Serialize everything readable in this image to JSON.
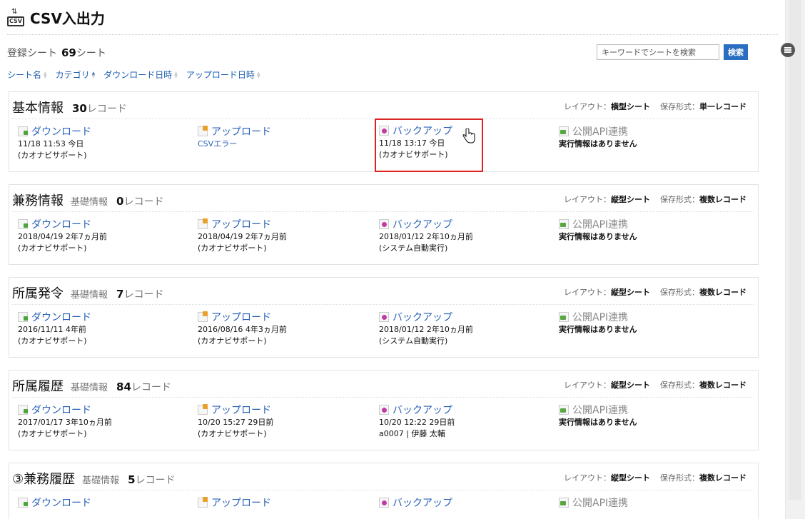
{
  "header": {
    "title": "CSV入出力",
    "icon_text": "CSV"
  },
  "summary": {
    "label": "登録シート",
    "count": "69",
    "unit": "シート"
  },
  "search": {
    "placeholder": "キーワードでシートを検索",
    "button": "検索"
  },
  "sort": [
    {
      "label": "シート名",
      "state": "none"
    },
    {
      "label": "カテゴリ",
      "state": "asc"
    },
    {
      "label": "ダウンロード日時",
      "state": "none"
    },
    {
      "label": "アップロード日時",
      "state": "none"
    }
  ],
  "meta_labels": {
    "layout": "レイアウト：",
    "format": "保存形式："
  },
  "action_labels": {
    "download": "ダウンロード",
    "upload": "アップロード",
    "backup": "バックアップ",
    "api": "公開API連携"
  },
  "cards": [
    {
      "name": "基本情報",
      "category": "",
      "count": "30",
      "unit": "レコード",
      "layout": "横型シート",
      "format": "単一レコード",
      "download": {
        "l1": "11/18 11:53 今日",
        "l2": "(カオナビサポート)"
      },
      "upload": {
        "l1": "CSVエラー",
        "l2": ""
      },
      "backup": {
        "l1": "11/18 13:17 今日",
        "l2": "(カオナビサポート)"
      },
      "api": {
        "l1": "実行情報はありません"
      }
    },
    {
      "name": "兼務情報",
      "category": "基礎情報",
      "count": "0",
      "unit": "レコード",
      "layout": "縦型シート",
      "format": "複数レコード",
      "download": {
        "l1": "2018/04/19 2年7ヵ月前",
        "l2": "(カオナビサポート)"
      },
      "upload": {
        "l1": "2018/04/19 2年7ヵ月前",
        "l2": "(カオナビサポート)"
      },
      "backup": {
        "l1": "2018/01/12 2年10ヵ月前",
        "l2": "(システム自動実行)"
      },
      "api": {
        "l1": "実行情報はありません"
      }
    },
    {
      "name": "所属発令",
      "category": "基礎情報",
      "count": "7",
      "unit": "レコード",
      "layout": "縦型シート",
      "format": "複数レコード",
      "download": {
        "l1": "2016/11/11 4年前",
        "l2": "(カオナビサポート)"
      },
      "upload": {
        "l1": "2016/08/16 4年3ヵ月前",
        "l2": "(カオナビサポート)"
      },
      "backup": {
        "l1": "2018/01/12 2年10ヵ月前",
        "l2": "(システム自動実行)"
      },
      "api": {
        "l1": "実行情報はありません"
      }
    },
    {
      "name": "所属履歴",
      "category": "基礎情報",
      "count": "84",
      "unit": "レコード",
      "layout": "縦型シート",
      "format": "複数レコード",
      "download": {
        "l1": "2017/01/17 3年10ヵ月前",
        "l2": "(カオナビサポート)"
      },
      "upload": {
        "l1": "10/20 15:27 29日前",
        "l2": "(カオナビサポート)"
      },
      "backup": {
        "l1": "10/20 12:22 29日前",
        "l2": "a0007 | 伊藤 太輔"
      },
      "api": {
        "l1": "実行情報はありません"
      }
    },
    {
      "name": "③兼務履歴",
      "category": "基礎情報",
      "count": "5",
      "unit": "レコード",
      "layout": "縦型シート",
      "format": "複数レコード",
      "download": {
        "l1": "",
        "l2": ""
      },
      "upload": {
        "l1": "",
        "l2": ""
      },
      "backup": {
        "l1": "",
        "l2": ""
      },
      "api": {
        "l1": ""
      }
    }
  ]
}
